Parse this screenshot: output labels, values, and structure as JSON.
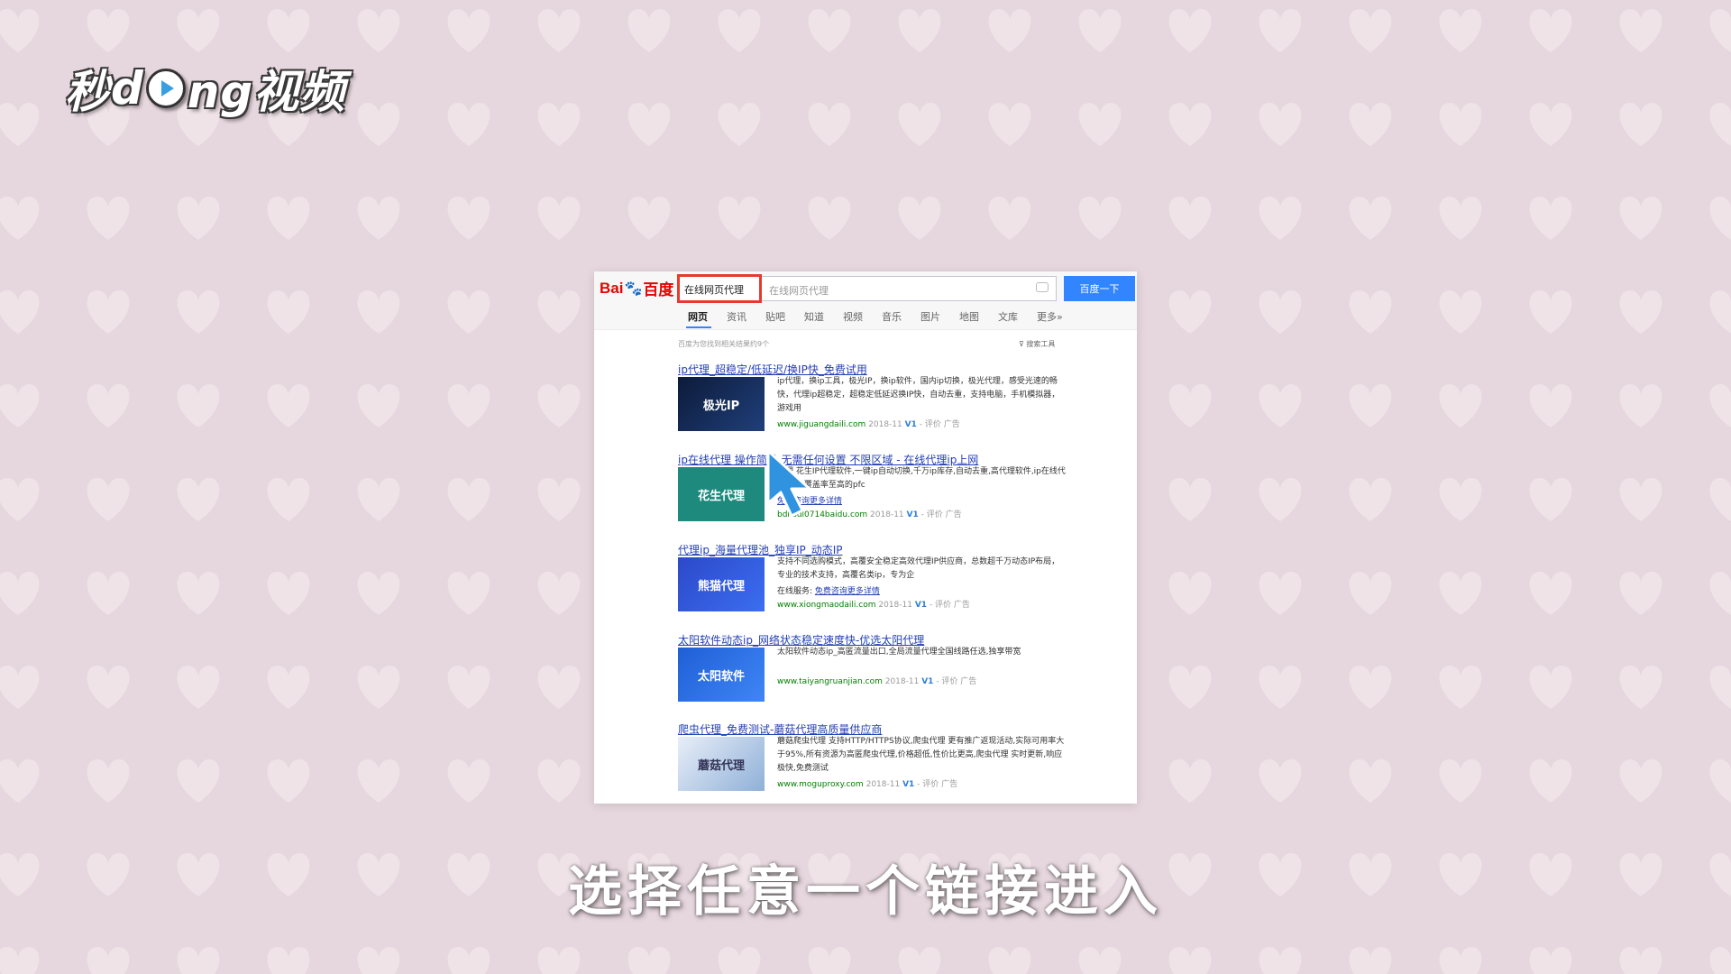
{
  "logo": {
    "part1": "秒",
    "part2": "d",
    "part3": "ng视频"
  },
  "subtitle": "选择任意一个链接进入",
  "baidu": {
    "logo_text": "Bai",
    "logo_cn": "百度",
    "query": "在线网页代理",
    "ghost_query": "在线网页代理",
    "search_button": "百度一下",
    "tabs": [
      "网页",
      "资讯",
      "贴吧",
      "知道",
      "视频",
      "音乐",
      "图片",
      "地图",
      "文库",
      "更多»"
    ],
    "meta": "百度为您找到相关结果约9个",
    "search_tools": "搜索工具",
    "results": [
      {
        "title": "ip代理_超稳定/低延迟/换IP快_免费试用",
        "thumb": "极光IP",
        "desc": "ip代理，换ip工具，极光IP，换ip软件，国内ip切换，极光代理，感受光速的畅快，代理ip超稳定，超稳定低延迟换IP快，自动去重，支持电脑，手机模拟器，游戏用",
        "url": "www.jiguangdaili.com",
        "date": "2018-11",
        "tail": "- 评价  广告"
      },
      {
        "title": "ip在线代理 操作简单 无需任何设置 不限区域 - 在线代理ip上网",
        "thumb": "花生代理",
        "desc": "代理 花生IP代理软件,一键ip自动切换,千万ip库存,自动去重,高代理软件,ip在线代理 业内覆盖率至高的pfc",
        "extra": "免费咨询更多详情",
        "url": "bdhsdl0714baidu.com",
        "date": "2018-11",
        "tail": "- 评价  广告"
      },
      {
        "title": "代理ip_海量代理池_独享IP_动态IP",
        "thumb": "熊猫代理",
        "desc": "支持不同选购模式，高覆安全稳定高效代理IP供应商，总数超千万动态IP布局，专业的技术支持，高覆名类ip，专为企",
        "extra_label": "在线服务:",
        "extra": "免费咨询更多详情",
        "url": "www.xiongmaodaili.com",
        "date": "2018-11",
        "tail": "- 评价  广告"
      },
      {
        "title": "太阳软件动态ip_网络状态稳定速度快-优选太阳代理",
        "thumb": "太阳软件",
        "desc": "太阳软件动态ip_高匿流量出口,全局流量代理全国线路任选,独享带宽",
        "url": "www.taiyangruanjian.com",
        "date": "2018-11",
        "tail": "- 评价  广告"
      },
      {
        "title": "爬虫代理_免费测试-蘑菇代理高质量供应商",
        "thumb": "蘑菇代理",
        "desc": "蘑菇爬虫代理 支持HTTP/HTTPS协议,爬虫代理 更有推广返现活动,实际可用率大于95%,所有资源为高匿爬虫代理,价格超低,性价比更高,爬虫代理 实时更新,响应极快,免费测试",
        "url": "www.moguproxy.com",
        "date": "2018-11",
        "tail": "- 评价  广告"
      }
    ]
  }
}
